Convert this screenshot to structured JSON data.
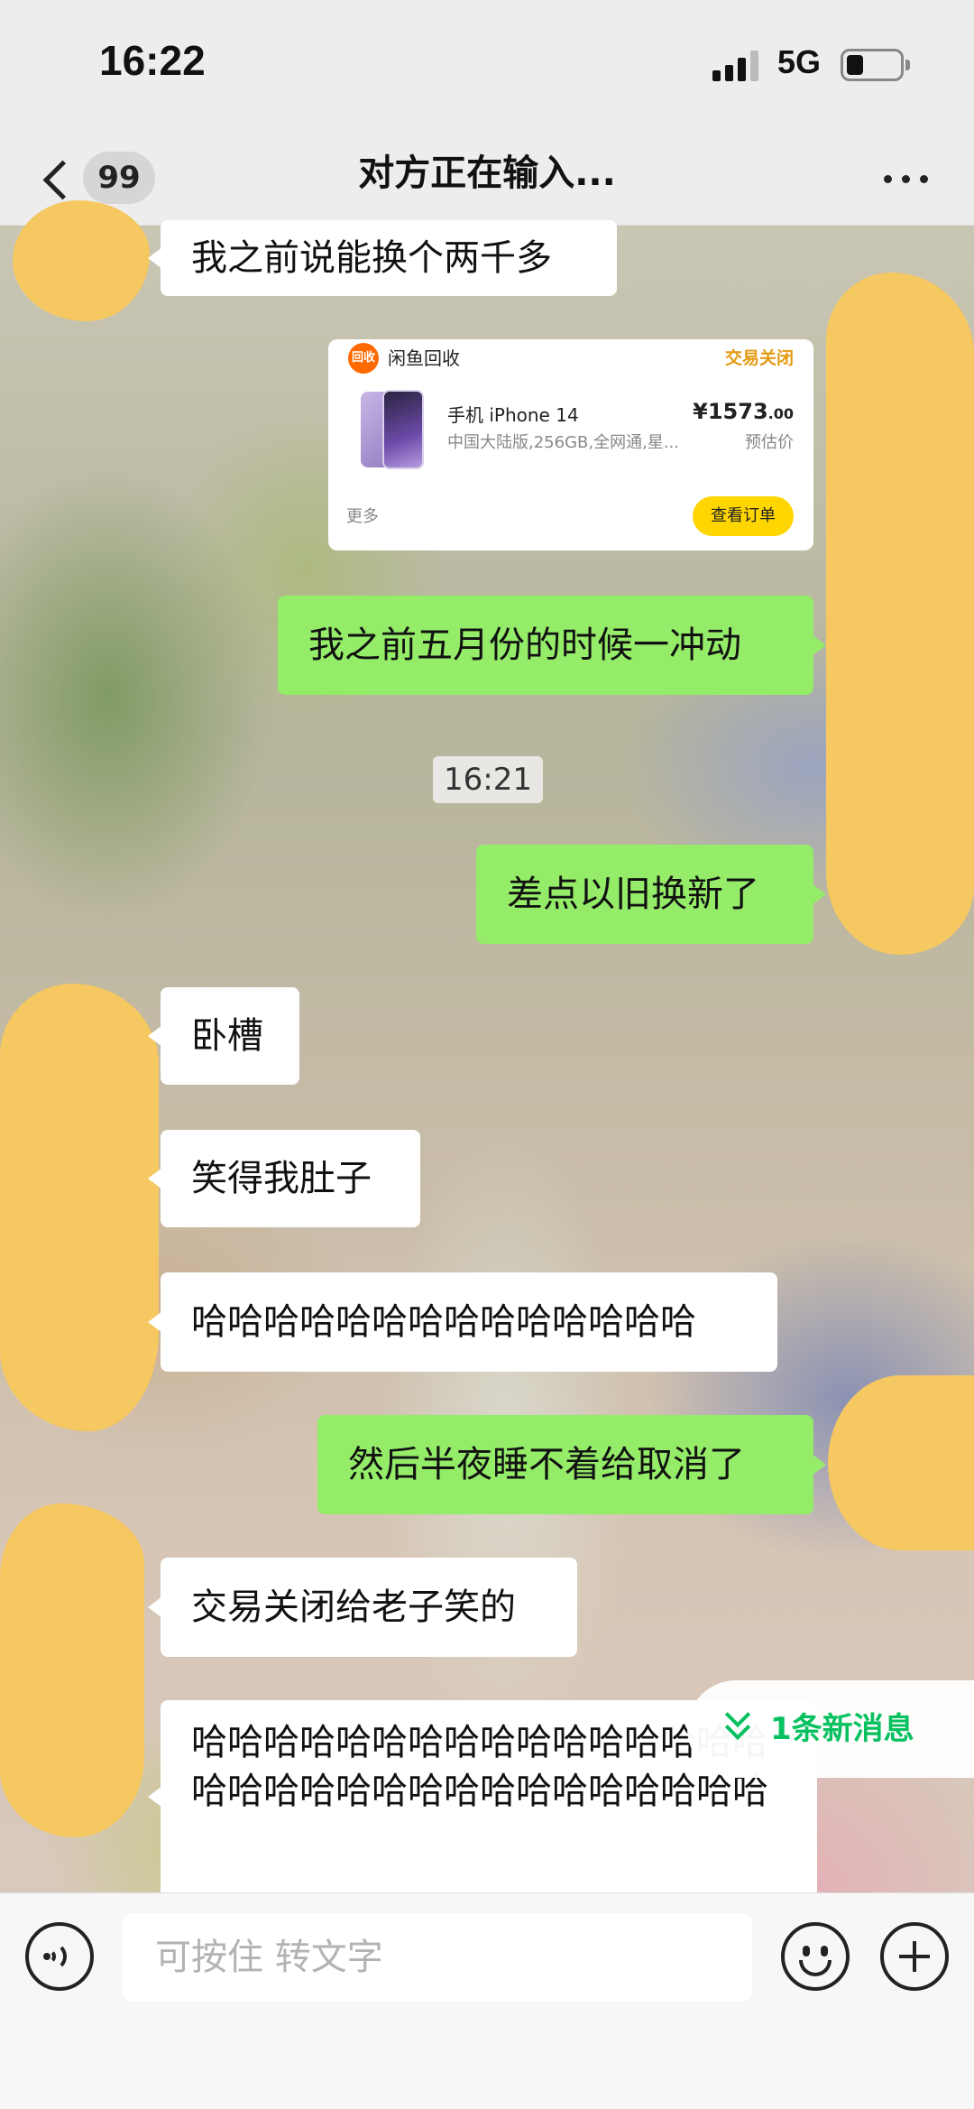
{
  "status_bar": {
    "time": "16:22",
    "network": "5G"
  },
  "header": {
    "unread_count": "99",
    "title": "对方正在输入..."
  },
  "messages": [
    {
      "from": "them",
      "text": "我之前说能换个两千多"
    },
    {
      "from": "me",
      "text": "我之前五月份的时候一冲动"
    },
    {
      "from": "me",
      "text": "差点以旧换新了"
    },
    {
      "from": "them",
      "text": "卧槽"
    },
    {
      "from": "them",
      "text": "笑得我肚子"
    },
    {
      "from": "them",
      "text": "哈哈哈哈哈哈哈哈哈哈哈哈哈哈"
    },
    {
      "from": "me",
      "text": "然后半夜睡不着给取消了"
    },
    {
      "from": "them",
      "text": "交易关闭给老子笑的"
    },
    {
      "from": "them",
      "text": "哈哈哈哈哈哈哈哈哈哈哈哈哈哈哈哈哈哈哈哈哈哈哈哈哈哈哈哈哈哈哈哈"
    }
  ],
  "timestamp": "16:21",
  "card": {
    "logo_text": "回收",
    "source": "闲鱼回收",
    "status": "交易关闭",
    "product_title": "手机 iPhone 14",
    "product_desc": "中国大陆版,256GB,全网通,星...",
    "price_main": "¥1573",
    "price_cents": ".00",
    "price_note": "预估价",
    "more": "更多",
    "order_button": "查看订单"
  },
  "new_messages": "1条新消息",
  "input": {
    "placeholder": "可按住 转文字"
  },
  "colors": {
    "outgoing_bubble": "#95ec69",
    "incoming_bubble": "#ffffff",
    "accent": "#07c160",
    "redaction": "#f6c862"
  },
  "icons": [
    "back-icon",
    "more-icon",
    "voice-icon",
    "emoji-icon",
    "plus-icon",
    "chevron-down-icon"
  ]
}
